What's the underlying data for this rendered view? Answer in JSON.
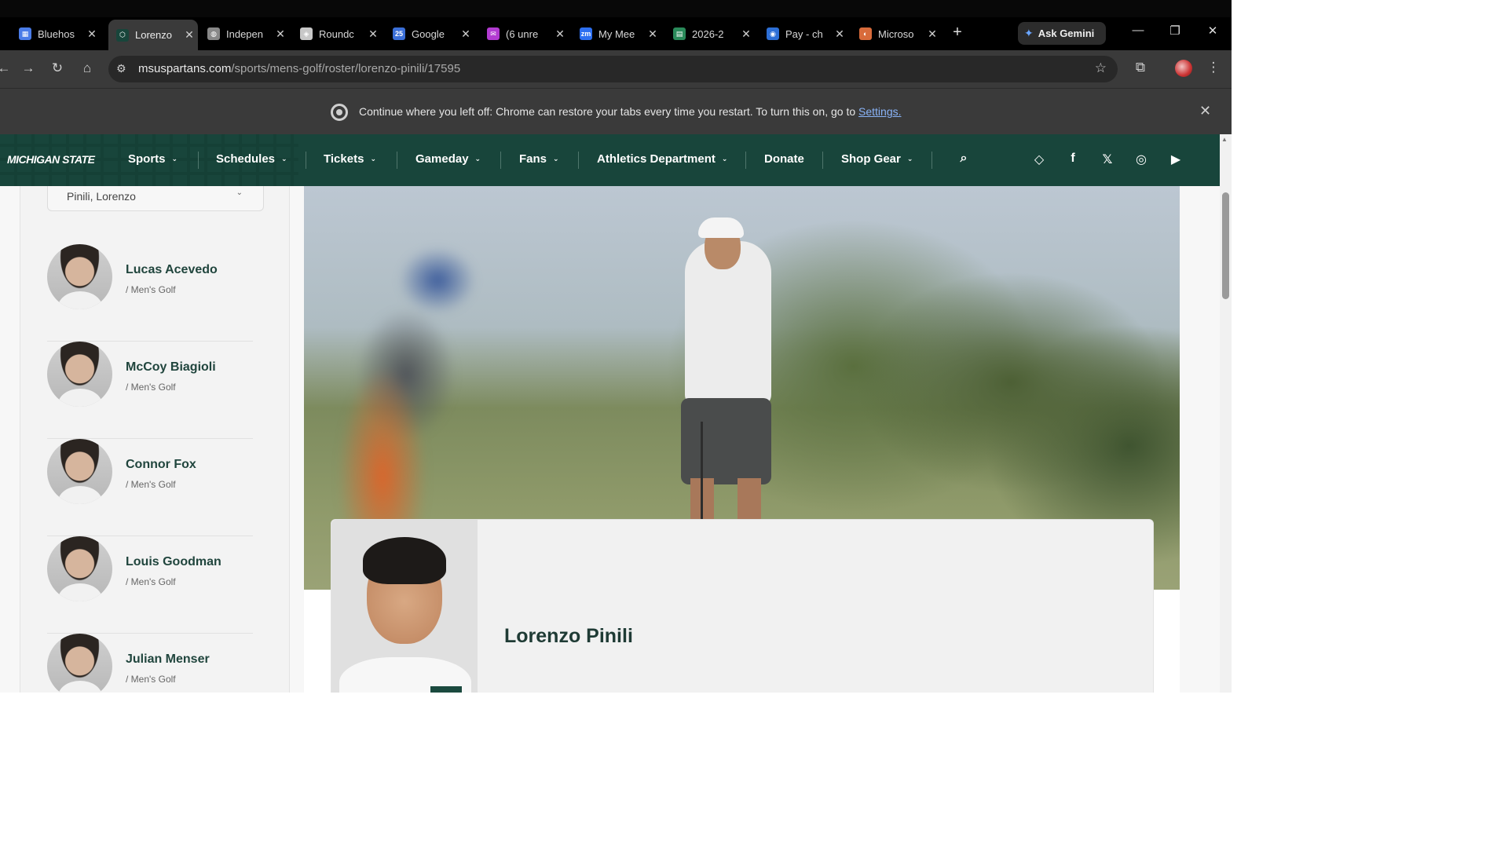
{
  "browser": {
    "tabs": [
      {
        "title": "Bluehos",
        "favicon": "grid-icon",
        "color": "#4a7ce8"
      },
      {
        "title": "Lorenzo",
        "favicon": "msu-icon",
        "color": "#18453b"
      },
      {
        "title": "Indepen",
        "favicon": "globe-icon",
        "color": "#888888"
      },
      {
        "title": "Roundc",
        "favicon": "shield-icon",
        "color": "#c8c8c8"
      },
      {
        "title": "Google",
        "favicon": "calendar-icon",
        "color": "#3b6fd8"
      },
      {
        "title": "(6 unre",
        "favicon": "mail-icon",
        "color": "#b23bd1"
      },
      {
        "title": "My Mee",
        "favicon": "zoom-icon",
        "color": "#2d6ff0"
      },
      {
        "title": "2026-2",
        "favicon": "sheet-icon",
        "color": "#2a8a5a"
      },
      {
        "title": "Pay - ch",
        "favicon": "pay-icon",
        "color": "#2d6fd6"
      },
      {
        "title": "Microso",
        "favicon": "copilot-icon",
        "color": "#d86b3b"
      }
    ],
    "close_glyph": "✕",
    "new_tab": "+",
    "ask_gemini": "Ask Gemini",
    "url_host": "msuspartans.com",
    "url_path": "/sports/mens-golf/roster/lorenzo-pinili/17595",
    "infobar_text": "Continue where you left off: Chrome can restore your tabs every time you restart. To turn this on, go to ",
    "infobar_link": "Settings."
  },
  "site": {
    "logo": "MICHIGAN STATE",
    "nav": [
      "Sports",
      "Schedules",
      "Tickets",
      "Gameday",
      "Fans",
      "Athletics Department",
      "Donate",
      "Shop Gear"
    ],
    "nav_has_dropdown": [
      true,
      true,
      true,
      true,
      true,
      true,
      false,
      true
    ],
    "social": [
      "ticket-icon",
      "facebook-icon",
      "x-icon",
      "instagram-icon",
      "youtube-icon"
    ]
  },
  "roster": {
    "selected": "Pinili, Lorenzo",
    "players": [
      {
        "name": "Lucas Acevedo",
        "sport": "/ Men's Golf"
      },
      {
        "name": "McCoy Biagioli",
        "sport": "/ Men's Golf"
      },
      {
        "name": "Connor Fox",
        "sport": "/ Men's Golf"
      },
      {
        "name": "Louis Goodman",
        "sport": "/ Men's Golf"
      },
      {
        "name": "Julian Menser",
        "sport": "/ Men's Golf"
      }
    ]
  },
  "profile": {
    "name": "Lorenzo Pinili"
  }
}
